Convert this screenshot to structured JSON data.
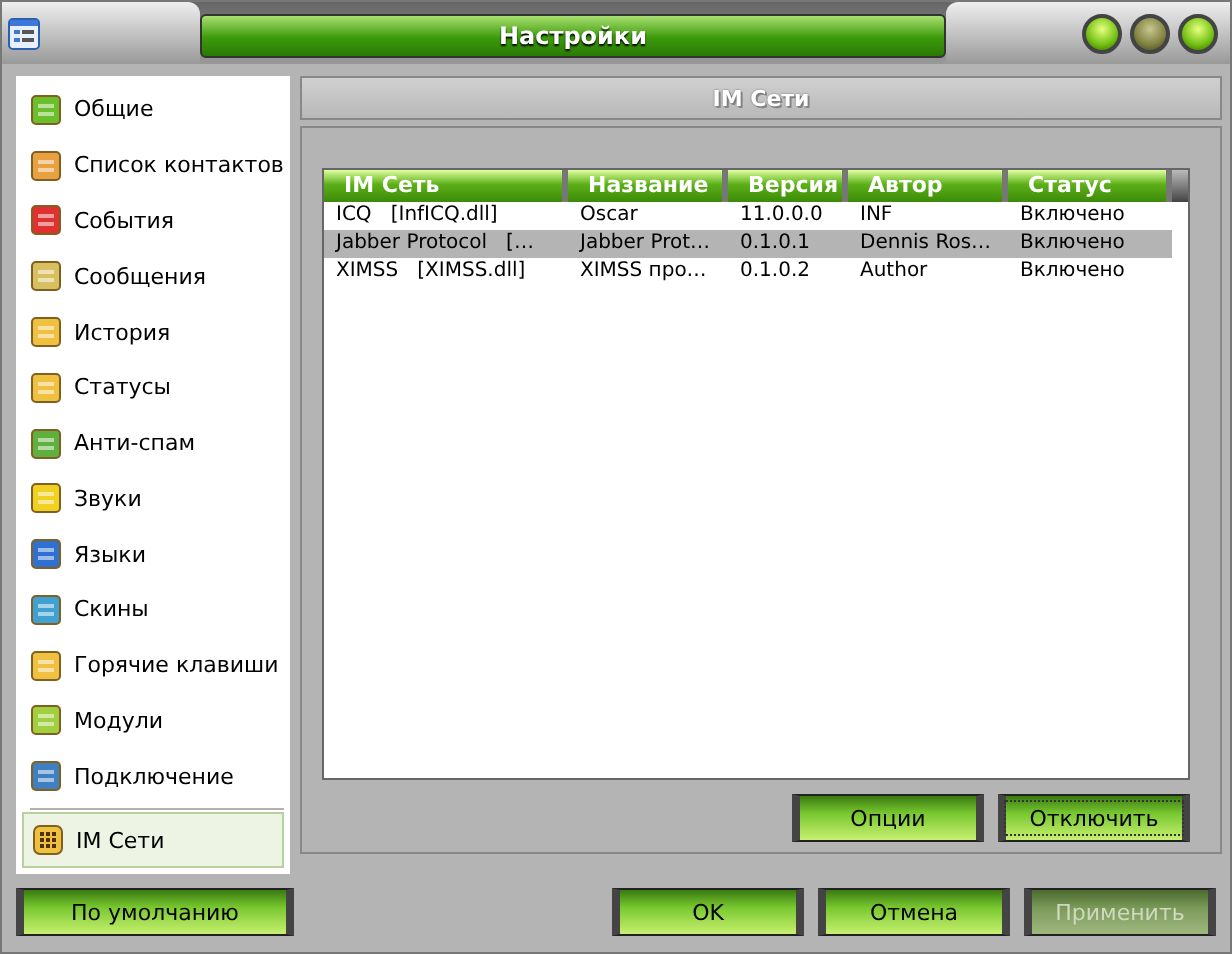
{
  "window": {
    "title": "Настройки"
  },
  "sidebar": {
    "items": [
      {
        "label": "Общие",
        "selected": false
      },
      {
        "label": "Список контактов",
        "selected": false
      },
      {
        "label": "События",
        "selected": false
      },
      {
        "label": "Сообщения",
        "selected": false
      },
      {
        "label": "История",
        "selected": false
      },
      {
        "label": "Статусы",
        "selected": false
      },
      {
        "label": "Анти-спам",
        "selected": false
      },
      {
        "label": "Звуки",
        "selected": false
      },
      {
        "label": "Языки",
        "selected": false
      },
      {
        "label": "Скины",
        "selected": false
      },
      {
        "label": "Горячие клавиши",
        "selected": false
      },
      {
        "label": "Модули",
        "selected": false
      },
      {
        "label": "Подключение",
        "selected": false
      }
    ],
    "bottom_item": {
      "label": "IM Сети",
      "selected": true
    }
  },
  "panel": {
    "title": "IM Сети"
  },
  "table": {
    "columns": [
      "IM Сеть",
      "Название",
      "Версия",
      "Автор",
      "Статус"
    ],
    "rows": [
      {
        "cells": [
          "ICQ   [InfICQ.dll]",
          "Oscar",
          "11.0.0.0",
          "INF",
          "Включено"
        ],
        "selected": false
      },
      {
        "cells": [
          "Jabber Protocol   […",
          "Jabber Prot…",
          "0.1.0.1",
          "Dennis Ros…",
          "Включено"
        ],
        "selected": true
      },
      {
        "cells": [
          "XIMSS   [XIMSS.dll]",
          "XIMSS про…",
          "0.1.0.2",
          "Author",
          "Включено"
        ],
        "selected": false
      }
    ]
  },
  "panel_buttons": [
    {
      "label": "Опции",
      "focused": false,
      "disabled": false
    },
    {
      "label": "Отключить",
      "focused": true,
      "disabled": false
    }
  ],
  "footer": {
    "left_button": {
      "label": "По умолчанию",
      "focused": false,
      "disabled": false
    },
    "buttons": [
      {
        "label": "OK",
        "focused": false,
        "disabled": false
      },
      {
        "label": "Отмена",
        "focused": false,
        "disabled": false
      },
      {
        "label": "Применить",
        "focused": false,
        "disabled": true
      }
    ]
  }
}
